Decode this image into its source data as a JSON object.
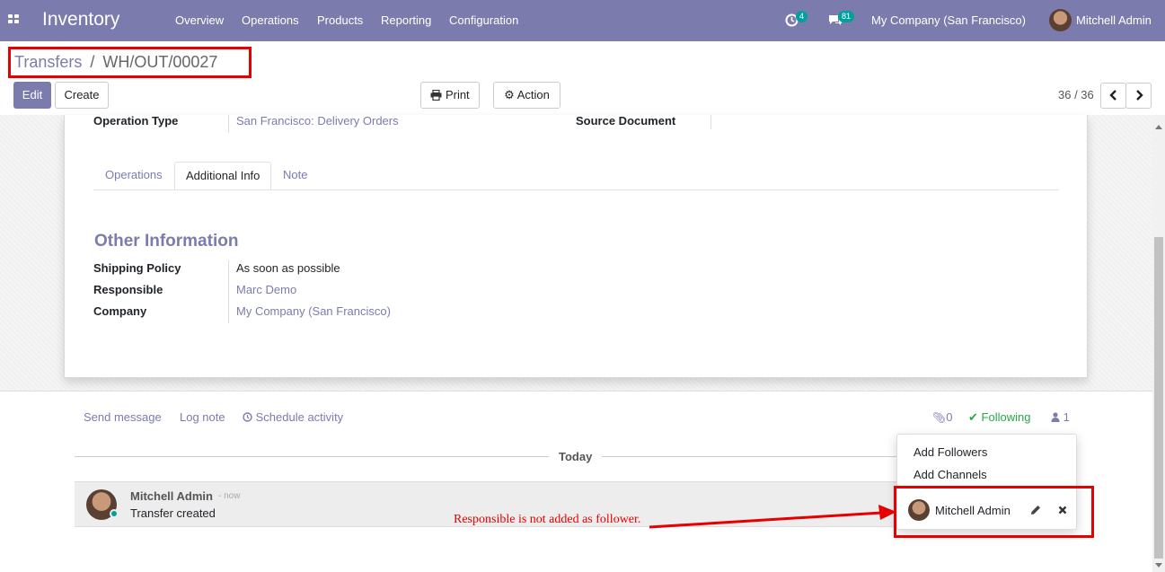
{
  "navbar": {
    "app_name": "Inventory",
    "menus": [
      "Overview",
      "Operations",
      "Products",
      "Reporting",
      "Configuration"
    ],
    "activity_count": "4",
    "messages_count": "81",
    "company": "My Company (San Francisco)",
    "user": "Mitchell Admin",
    "color": "#7c7bad"
  },
  "breadcrumb": {
    "parent": "Transfers",
    "separator": "/",
    "current": "WH/OUT/00027"
  },
  "toolbar": {
    "edit": "Edit",
    "create": "Create",
    "print": "Print",
    "action": "Action"
  },
  "pager": {
    "value": "36 / 36"
  },
  "form": {
    "operation_type_label": "Operation Type",
    "operation_type_value": "San Francisco: Delivery Orders",
    "source_document_label": "Source Document",
    "tabs": [
      "Operations",
      "Additional Info",
      "Note"
    ],
    "active_tab": "Additional Info",
    "section_title": "Other Information",
    "fields": [
      {
        "label": "Shipping Policy",
        "value": "As soon as possible"
      },
      {
        "label": "Responsible",
        "value": "Marc Demo"
      },
      {
        "label": "Company",
        "value": "My Company (San Francisco)"
      }
    ]
  },
  "chatter": {
    "send_message": "Send message",
    "log_note": "Log note",
    "schedule_activity": "Schedule activity",
    "attachments_count": "0",
    "following": "Following",
    "followers_count": "1",
    "today": "Today",
    "message": {
      "author": "Mitchell Admin",
      "time": "- now",
      "body": "Transfer created"
    }
  },
  "followers_dropdown": {
    "add_followers": "Add Followers",
    "add_channels": "Add Channels",
    "follower_name": "Mitchell Admin"
  },
  "annotation": {
    "text": "Responsible is not added as follower.",
    "color": "#e60000"
  }
}
